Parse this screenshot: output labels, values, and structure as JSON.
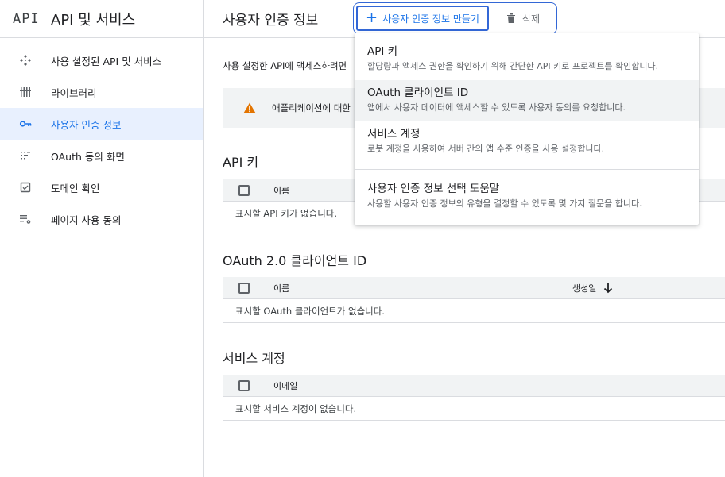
{
  "brand": {
    "logo": "API",
    "title": "API 및 서비스"
  },
  "sidebar": {
    "items": [
      {
        "label": "사용 설정된 API 및 서비스",
        "icon": "dashboard-icon"
      },
      {
        "label": "라이브러리",
        "icon": "library-icon"
      },
      {
        "label": "사용자 인증 정보",
        "icon": "key-icon",
        "active": true
      },
      {
        "label": "OAuth 동의 화면",
        "icon": "consent-icon"
      },
      {
        "label": "도메인 확인",
        "icon": "checkbox-icon"
      },
      {
        "label": "페이지 사용 동의",
        "icon": "settings-list-icon"
      }
    ]
  },
  "header": {
    "title": "사용자 인증 정보",
    "create_label": "사용자 인증 정보 만들기",
    "delete_label": "삭제"
  },
  "content": {
    "intro": "사용 설정한 API에 액세스하려면",
    "banner_text": "애플리케이션에 대한",
    "api_keys": {
      "title": "API 키",
      "col_name": "이름",
      "empty": "표시할 API 키가 없습니다."
    },
    "oauth": {
      "title": "OAuth 2.0 클라이언트 ID",
      "col_name": "이름",
      "col_created": "생성일",
      "empty": "표시할 OAuth 클라이언트가 없습니다."
    },
    "service_accounts": {
      "title": "서비스 계정",
      "col_email": "이메일",
      "empty": "표시할 서비스 계정이 없습니다."
    }
  },
  "menu": {
    "items": [
      {
        "title": "API 키",
        "desc": "할당량과 액세스 권한을 확인하기 위해 간단한 API 키로 프로젝트를 확인합니다."
      },
      {
        "title": "OAuth 클라이언트 ID",
        "desc": "앱에서 사용자 데이터에 액세스할 수 있도록 사용자 동의를 요청합니다."
      },
      {
        "title": "서비스 계정",
        "desc": "로봇 계정을 사용하여 서버 간의 앱 수준 인증을 사용 설정합니다."
      }
    ],
    "help": {
      "title": "사용자 인증 정보 선택 도움말",
      "desc": "사용할 사용자 인증 정보의 유형을 결정할 수 있도록 몇 가지 질문을 합니다."
    }
  },
  "colors": {
    "accent": "#1a73e8",
    "active_bg": "#e8f0fe",
    "warning": "#e37400"
  }
}
